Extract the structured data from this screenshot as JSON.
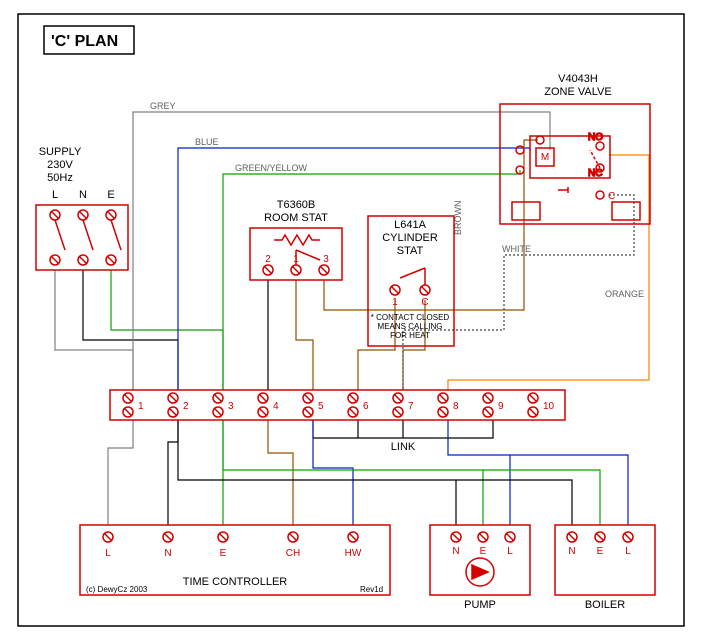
{
  "title": "'C' PLAN",
  "supply": {
    "label": "SUPPLY",
    "voltage": "230V",
    "freq": "50Hz",
    "terms": [
      "L",
      "N",
      "E"
    ]
  },
  "roomstat": {
    "model": "T6360B",
    "label": "ROOM STAT",
    "terms": [
      "2",
      "1",
      "3"
    ]
  },
  "cylstat": {
    "model": "L641A",
    "label1": "CYLINDER",
    "label2": "STAT",
    "terms": [
      "1",
      "C"
    ],
    "note1": "* CONTACT CLOSED",
    "note2": "MEANS CALLING",
    "note3": "FOR HEAT"
  },
  "valve": {
    "model": "V4043H",
    "label": "ZONE VALVE",
    "m": "M",
    "no": "NO",
    "nc": "NC",
    "c": "C"
  },
  "junction": {
    "terms": [
      "1",
      "2",
      "3",
      "4",
      "5",
      "6",
      "7",
      "8",
      "9",
      "10"
    ],
    "link": "LINK"
  },
  "timer": {
    "label": "TIME CONTROLLER",
    "terms": [
      "L",
      "N",
      "E",
      "CH",
      "HW"
    ],
    "rev": "Rev1d",
    "copy": "(c) DewyCz 2003"
  },
  "pump": {
    "label": "PUMP",
    "terms": [
      "N",
      "E",
      "L"
    ]
  },
  "boiler": {
    "label": "BOILER",
    "terms": [
      "N",
      "E",
      "L"
    ]
  },
  "wirelabels": {
    "grey": "GREY",
    "blue": "BLUE",
    "green": "GREEN/YELLOW",
    "brown": "BROWN",
    "white": "WHITE",
    "orange": "ORANGE"
  }
}
